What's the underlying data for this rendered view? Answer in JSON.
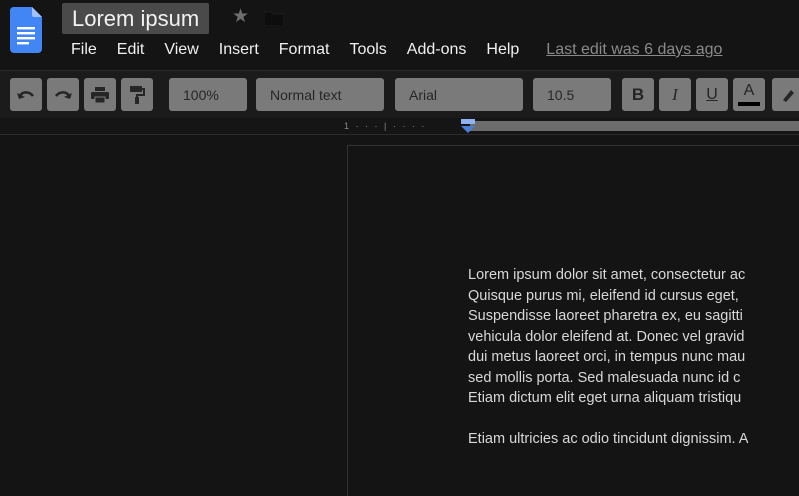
{
  "header": {
    "doc_title": "Lorem ipsum",
    "star_icon": "star-icon",
    "folder_icon": "folder-icon"
  },
  "menu": {
    "items": [
      "File",
      "Edit",
      "View",
      "Insert",
      "Format",
      "Tools",
      "Add-ons",
      "Help"
    ],
    "last_edit": "Last edit was 6 days ago"
  },
  "toolbar": {
    "undo_icon": "undo-icon",
    "redo_icon": "redo-icon",
    "print_icon": "print-icon",
    "paint_format_icon": "paint-format-icon",
    "zoom": "100%",
    "style": "Normal text",
    "font": "Arial",
    "font_size": "10.5",
    "bold": "B",
    "italic": "I",
    "underline": "U",
    "text_color": "A"
  },
  "document": {
    "paragraph1": [
      "Lorem ipsum dolor sit amet, consectetur ac",
      "Quisque purus mi, eleifend id cursus eget, ",
      "Suspendisse laoreet pharetra ex, eu sagitti",
      "vehicula dolor eleifend at. Donec vel gravid",
      "dui metus laoreet orci, in tempus nunc mau",
      "sed mollis porta. Sed malesuada nunc id c",
      "Etiam dictum elit eget urna aliquam tristiqu"
    ],
    "paragraph2": [
      "Etiam ultricies ac odio tincidunt dignissim. A"
    ]
  },
  "colors": {
    "background": "#141414",
    "toolbar_button": "#7a7a7a",
    "title_box": "#4a4a4a",
    "docs_blue": "#4285f4"
  }
}
